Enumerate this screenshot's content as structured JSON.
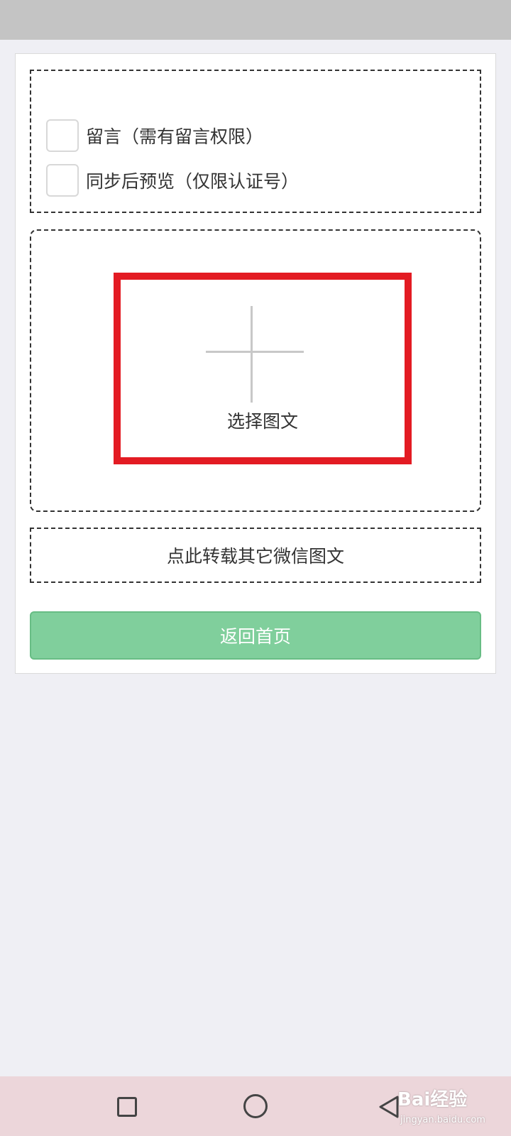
{
  "options": {
    "comment_label": "留言（需有留言权限）",
    "preview_label": "同步后预览（仅限认证号）"
  },
  "upload": {
    "select_label": "选择图文"
  },
  "repost_link_label": "点此转载其它微信图文",
  "home_button_label": "返回首页",
  "watermark": {
    "brand": "Bai经验",
    "url": "jingyan.baidu.com"
  },
  "colors": {
    "highlight": "#e31b23",
    "primary_button": "#80cf9c",
    "background": "#efeff4"
  },
  "icons": {
    "plus": "plus-icon",
    "nav_recent": "square-icon",
    "nav_home": "circle-icon",
    "nav_back": "back-triangle-icon"
  }
}
